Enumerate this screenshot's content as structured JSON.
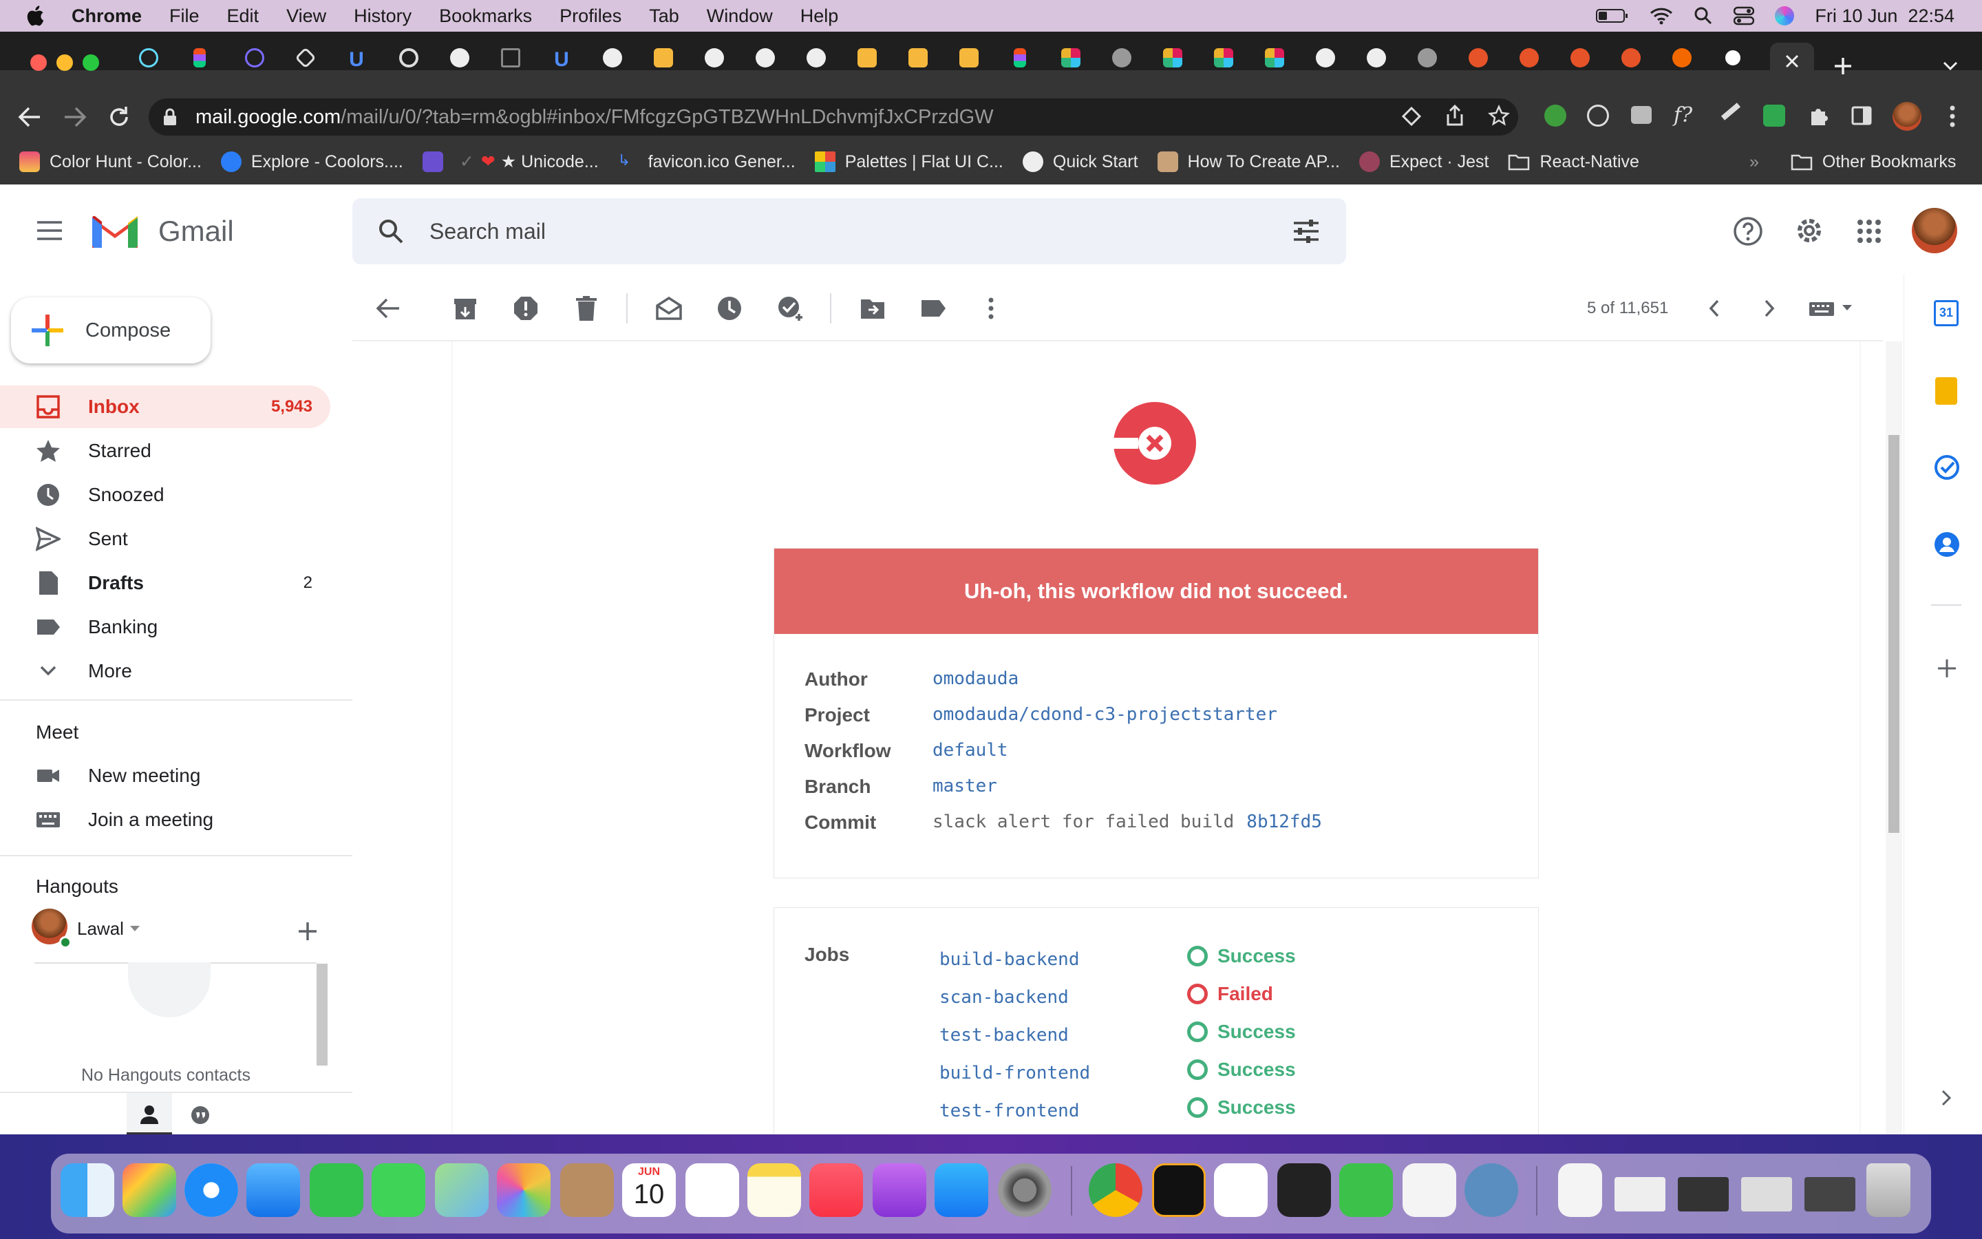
{
  "menubar": {
    "app": "Chrome",
    "items": [
      "File",
      "Edit",
      "View",
      "History",
      "Bookmarks",
      "Profiles",
      "Tab",
      "Window",
      "Help"
    ],
    "clock": "Fri 10 Jun  22:54"
  },
  "browser": {
    "url_domain": "mail.google.com",
    "url_path": "/mail/u/0/?tab=rm&ogbl#inbox/FMfcgzGpGTBZWHnLDchvmjfJxCPrzdGW",
    "bookmarks": [
      "Color Hunt - Color...",
      "Explore - Coolors....",
      "",
      "★ Unicode...",
      "favicon.ico Gener...",
      "Palettes | Flat UI C...",
      "Quick Start",
      "How To Create AP...",
      "Expect · Jest",
      "React-Native"
    ],
    "other_bookmarks": "Other Bookmarks",
    "more": "»"
  },
  "gmail": {
    "logo": "Gmail",
    "search_placeholder": "Search mail",
    "compose": "Compose",
    "nav": [
      {
        "label": "Inbox",
        "count": "5,943"
      },
      {
        "label": "Starred",
        "count": ""
      },
      {
        "label": "Snoozed",
        "count": ""
      },
      {
        "label": "Sent",
        "count": ""
      },
      {
        "label": "Drafts",
        "count": "2"
      },
      {
        "label": "Banking",
        "count": ""
      },
      {
        "label": "More",
        "count": ""
      }
    ],
    "meet": {
      "title": "Meet",
      "new": "New meeting",
      "join": "Join a meeting"
    },
    "hangouts": {
      "title": "Hangouts",
      "user": "Lawal",
      "empty": "No Hangouts contacts"
    },
    "pager": "5 of 11,651"
  },
  "email": {
    "banner": "Uh-oh, this workflow did not succeed.",
    "fields": [
      {
        "k": "Author",
        "v": "omodauda"
      },
      {
        "k": "Project",
        "v": "omodauda/cdond-c3-projectstarter"
      },
      {
        "k": "Workflow",
        "v": "default"
      },
      {
        "k": "Branch",
        "v": "master"
      },
      {
        "k": "Commit",
        "v": "slack alert for failed build",
        "hash": "8b12fd5"
      }
    ],
    "jobs_label": "Jobs",
    "jobs": [
      {
        "name": "build-backend",
        "status": "Success"
      },
      {
        "name": "scan-backend",
        "status": "Failed"
      },
      {
        "name": "test-backend",
        "status": "Success"
      },
      {
        "name": "build-frontend",
        "status": "Success"
      },
      {
        "name": "test-frontend",
        "status": "Success"
      }
    ]
  },
  "colors": {
    "success": "#43b07d",
    "failed": "#e0444a",
    "banner": "#e06666",
    "inbox_red": "#d93025"
  },
  "dock": {
    "calendar_month": "JUN",
    "calendar_day": "10"
  }
}
